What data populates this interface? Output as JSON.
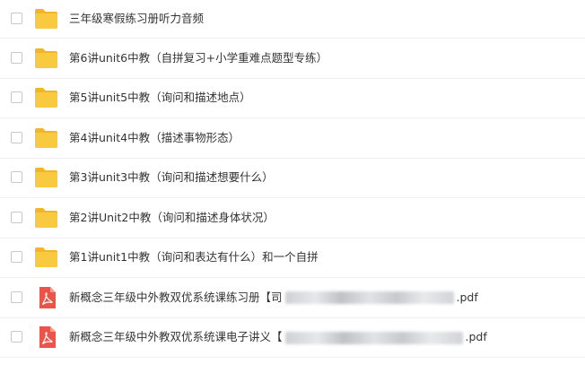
{
  "files": [
    {
      "type": "folder",
      "name": "三年级寒假练习册听力音频"
    },
    {
      "type": "folder",
      "name": "第6讲unit6中教（自拼复习+小学重难点题型专练）"
    },
    {
      "type": "folder",
      "name": "第5讲unit5中教（询问和描述地点）"
    },
    {
      "type": "folder",
      "name": "第4讲unit4中教（描述事物形态）"
    },
    {
      "type": "folder",
      "name": "第3讲unit3中教（询问和描述想要什么）"
    },
    {
      "type": "folder",
      "name": "第2讲Unit2中教（询问和描述身体状况）"
    },
    {
      "type": "folder",
      "name": "第1讲unit1中教（询问和表达有什么）和一个自拼"
    },
    {
      "type": "pdf",
      "name_prefix": "新概念三年级中外教双优系统课练习册【司",
      "name_suffix": ".pdf"
    },
    {
      "type": "pdf",
      "name_prefix": "新概念三年级中外教双优系统课电子讲义【",
      "name_suffix": ".pdf"
    }
  ],
  "colors": {
    "folder": "#f9c940",
    "folder_back": "#f2b52a",
    "pdf": "#ee5349",
    "text": "#333333",
    "divider": "#f0f0f0"
  }
}
